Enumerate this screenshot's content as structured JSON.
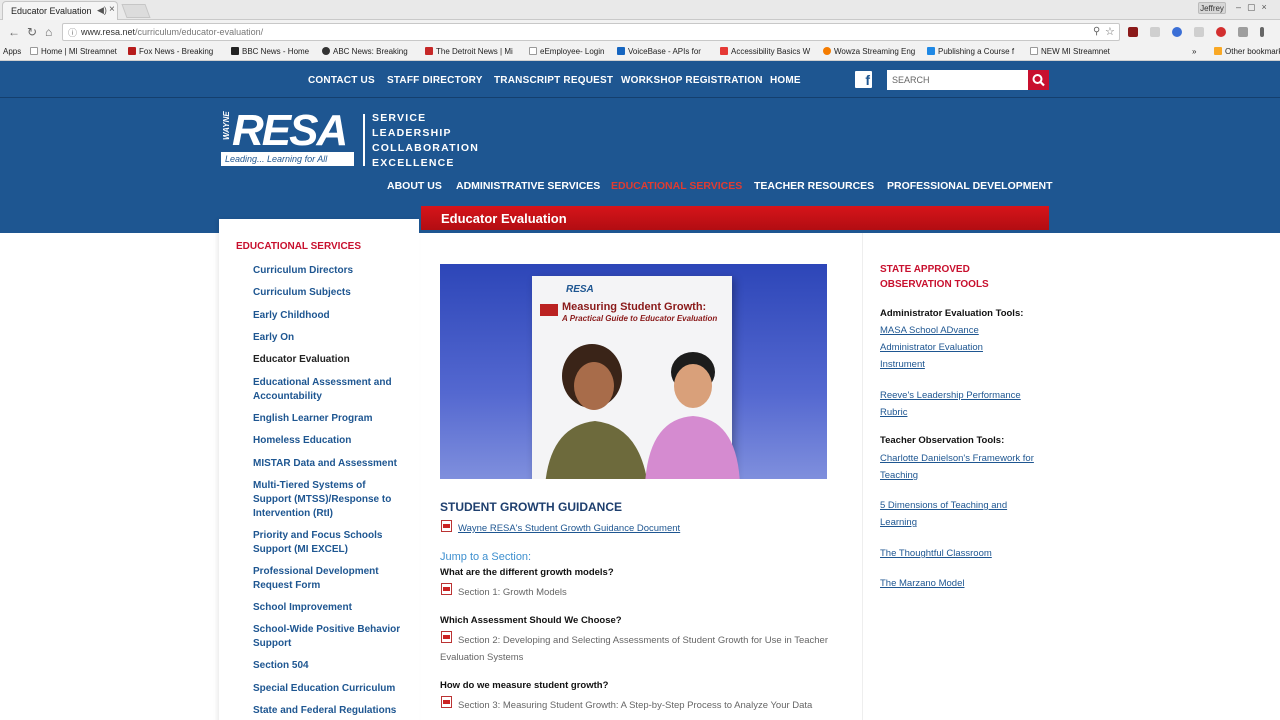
{
  "browser": {
    "tab_title": "Educator Evaluation",
    "user_chip": "Jeffrey",
    "url_host": "www.resa.net",
    "url_path": "/curriculum/educator-evaluation/",
    "bookmarks": [
      {
        "label": "Apps"
      },
      {
        "label": "Home | MI Streamnet"
      },
      {
        "label": "Fox News - Breaking"
      },
      {
        "label": "BBC News - Home"
      },
      {
        "label": "ABC News: Breaking"
      },
      {
        "label": "The Detroit News | Mi"
      },
      {
        "label": "eEmployee- Login"
      },
      {
        "label": "VoiceBase - APIs for"
      },
      {
        "label": "Accessibility Basics W"
      },
      {
        "label": "Wowza Streaming Eng"
      },
      {
        "label": "Publishing a Course f"
      },
      {
        "label": "NEW MI Streamnet"
      },
      {
        "label": "Other bookmarks"
      }
    ]
  },
  "topnav": {
    "links": [
      "CONTACT US",
      "STAFF DIRECTORY",
      "TRANSCRIPT REQUEST",
      "WORKSHOP REGISTRATION",
      "HOME"
    ],
    "search_placeholder": "SEARCH"
  },
  "logo": {
    "wayne": "WAYNE",
    "name": "RESA",
    "tag": "Leading... Learning for All",
    "tagline": [
      "SERVICE",
      "LEADERSHIP",
      "COLLABORATION",
      "EXCELLENCE"
    ]
  },
  "mainnav": [
    "ABOUT US",
    "ADMINISTRATIVE SERVICES",
    "EDUCATIONAL SERVICES",
    "TEACHER RESOURCES",
    "PROFESSIONAL DEVELOPMENT"
  ],
  "page_title": "Educator Evaluation",
  "sidebar": {
    "heading": "EDUCATIONAL SERVICES",
    "items": [
      "Curriculum Directors",
      "Curriculum Subjects",
      "Early Childhood",
      "Early On",
      "Educator Evaluation",
      "Educational Assessment and Accountability",
      "English Learner Program",
      "Homeless Education",
      "MISTAR Data and Assessment",
      "Multi-Tiered Systems of Support (MTSS)/Response to Intervention (RtI)",
      "Priority and Focus Schools Support (MI EXCEL)",
      "Professional Development Request Form",
      "School Improvement",
      "School-Wide Positive Behavior Support",
      "Section 504",
      "Special Education Curriculum",
      "State and Federal Regulations"
    ]
  },
  "hero": {
    "cover_logo": "RESA",
    "cover_title": "Measuring Student Growth:",
    "cover_subtitle": "A Practical Guide to Educator Evaluation"
  },
  "main": {
    "section_title": "STUDENT GROWTH GUIDANCE",
    "doc_link": "Wayne RESA's Student Growth Guidance Document",
    "jump": "Jump to a Section:",
    "questions": [
      {
        "q": "What are the different growth models?",
        "link": "Section 1: Growth Models"
      },
      {
        "q": "Which Assessment Should We Choose?",
        "link": "Section 2: Developing and Selecting Assessments of Student Growth for Use in Teacher Evaluation Systems"
      },
      {
        "q": "How do we measure student growth?",
        "link": "Section 3: Measuring Student Growth: A Step-by-Step Process to Analyze Your Data"
      }
    ]
  },
  "right": {
    "heading": "STATE APPROVED OBSERVATION TOOLS",
    "admin_heading": "Administrator Evaluation Tools:",
    "admin_links": [
      "MASA School ADvance Administrator Evaluation Instrument",
      "Reeve's Leadership Performance Rubric"
    ],
    "teacher_heading": "Teacher Observation Tools:",
    "teacher_links": [
      "Charlotte Danielson's Framework for Teaching",
      "5 Dimensions of Teaching and Learning",
      "The Thoughtful Classroom",
      "The Marzano Model"
    ]
  }
}
